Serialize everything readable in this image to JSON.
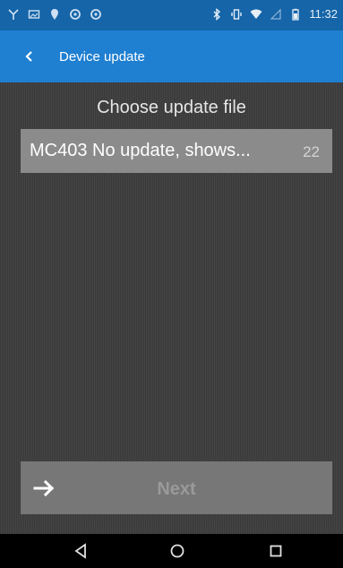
{
  "status_bar": {
    "time": "11:32"
  },
  "app_bar": {
    "title": "Device update"
  },
  "main": {
    "heading": "Choose update file",
    "files": [
      {
        "name": "MC403 No update, shows...",
        "size": "22"
      }
    ],
    "next_label": "Next"
  },
  "colors": {
    "status_bar": "#1565a8",
    "app_bar": "#1f7fd1",
    "background": "#404040",
    "file_item": "#8b8b8b",
    "next_button": "#777777"
  },
  "icons": {
    "back": "chevron-left-icon",
    "next": "arrow-right-icon",
    "nav": [
      "back-triangle-icon",
      "home-circle-icon",
      "recents-square-icon"
    ]
  }
}
